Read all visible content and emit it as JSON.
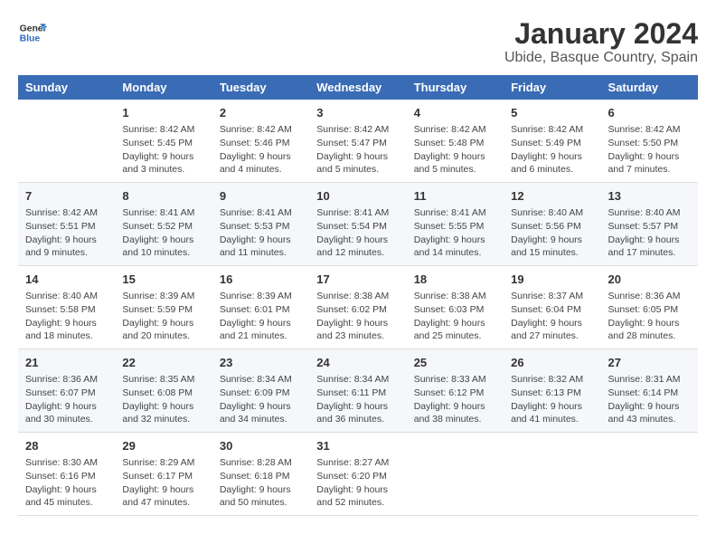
{
  "logo": {
    "text_general": "General",
    "text_blue": "Blue"
  },
  "title": "January 2024",
  "subtitle": "Ubide, Basque Country, Spain",
  "headers": [
    "Sunday",
    "Monday",
    "Tuesday",
    "Wednesday",
    "Thursday",
    "Friday",
    "Saturday"
  ],
  "weeks": [
    [
      {
        "day": "",
        "sunrise": "",
        "sunset": "",
        "daylight": ""
      },
      {
        "day": "1",
        "sunrise": "Sunrise: 8:42 AM",
        "sunset": "Sunset: 5:45 PM",
        "daylight": "Daylight: 9 hours and 3 minutes."
      },
      {
        "day": "2",
        "sunrise": "Sunrise: 8:42 AM",
        "sunset": "Sunset: 5:46 PM",
        "daylight": "Daylight: 9 hours and 4 minutes."
      },
      {
        "day": "3",
        "sunrise": "Sunrise: 8:42 AM",
        "sunset": "Sunset: 5:47 PM",
        "daylight": "Daylight: 9 hours and 5 minutes."
      },
      {
        "day": "4",
        "sunrise": "Sunrise: 8:42 AM",
        "sunset": "Sunset: 5:48 PM",
        "daylight": "Daylight: 9 hours and 5 minutes."
      },
      {
        "day": "5",
        "sunrise": "Sunrise: 8:42 AM",
        "sunset": "Sunset: 5:49 PM",
        "daylight": "Daylight: 9 hours and 6 minutes."
      },
      {
        "day": "6",
        "sunrise": "Sunrise: 8:42 AM",
        "sunset": "Sunset: 5:50 PM",
        "daylight": "Daylight: 9 hours and 7 minutes."
      }
    ],
    [
      {
        "day": "7",
        "sunrise": "Sunrise: 8:42 AM",
        "sunset": "Sunset: 5:51 PM",
        "daylight": "Daylight: 9 hours and 9 minutes."
      },
      {
        "day": "8",
        "sunrise": "Sunrise: 8:41 AM",
        "sunset": "Sunset: 5:52 PM",
        "daylight": "Daylight: 9 hours and 10 minutes."
      },
      {
        "day": "9",
        "sunrise": "Sunrise: 8:41 AM",
        "sunset": "Sunset: 5:53 PM",
        "daylight": "Daylight: 9 hours and 11 minutes."
      },
      {
        "day": "10",
        "sunrise": "Sunrise: 8:41 AM",
        "sunset": "Sunset: 5:54 PM",
        "daylight": "Daylight: 9 hours and 12 minutes."
      },
      {
        "day": "11",
        "sunrise": "Sunrise: 8:41 AM",
        "sunset": "Sunset: 5:55 PM",
        "daylight": "Daylight: 9 hours and 14 minutes."
      },
      {
        "day": "12",
        "sunrise": "Sunrise: 8:40 AM",
        "sunset": "Sunset: 5:56 PM",
        "daylight": "Daylight: 9 hours and 15 minutes."
      },
      {
        "day": "13",
        "sunrise": "Sunrise: 8:40 AM",
        "sunset": "Sunset: 5:57 PM",
        "daylight": "Daylight: 9 hours and 17 minutes."
      }
    ],
    [
      {
        "day": "14",
        "sunrise": "Sunrise: 8:40 AM",
        "sunset": "Sunset: 5:58 PM",
        "daylight": "Daylight: 9 hours and 18 minutes."
      },
      {
        "day": "15",
        "sunrise": "Sunrise: 8:39 AM",
        "sunset": "Sunset: 5:59 PM",
        "daylight": "Daylight: 9 hours and 20 minutes."
      },
      {
        "day": "16",
        "sunrise": "Sunrise: 8:39 AM",
        "sunset": "Sunset: 6:01 PM",
        "daylight": "Daylight: 9 hours and 21 minutes."
      },
      {
        "day": "17",
        "sunrise": "Sunrise: 8:38 AM",
        "sunset": "Sunset: 6:02 PM",
        "daylight": "Daylight: 9 hours and 23 minutes."
      },
      {
        "day": "18",
        "sunrise": "Sunrise: 8:38 AM",
        "sunset": "Sunset: 6:03 PM",
        "daylight": "Daylight: 9 hours and 25 minutes."
      },
      {
        "day": "19",
        "sunrise": "Sunrise: 8:37 AM",
        "sunset": "Sunset: 6:04 PM",
        "daylight": "Daylight: 9 hours and 27 minutes."
      },
      {
        "day": "20",
        "sunrise": "Sunrise: 8:36 AM",
        "sunset": "Sunset: 6:05 PM",
        "daylight": "Daylight: 9 hours and 28 minutes."
      }
    ],
    [
      {
        "day": "21",
        "sunrise": "Sunrise: 8:36 AM",
        "sunset": "Sunset: 6:07 PM",
        "daylight": "Daylight: 9 hours and 30 minutes."
      },
      {
        "day": "22",
        "sunrise": "Sunrise: 8:35 AM",
        "sunset": "Sunset: 6:08 PM",
        "daylight": "Daylight: 9 hours and 32 minutes."
      },
      {
        "day": "23",
        "sunrise": "Sunrise: 8:34 AM",
        "sunset": "Sunset: 6:09 PM",
        "daylight": "Daylight: 9 hours and 34 minutes."
      },
      {
        "day": "24",
        "sunrise": "Sunrise: 8:34 AM",
        "sunset": "Sunset: 6:11 PM",
        "daylight": "Daylight: 9 hours and 36 minutes."
      },
      {
        "day": "25",
        "sunrise": "Sunrise: 8:33 AM",
        "sunset": "Sunset: 6:12 PM",
        "daylight": "Daylight: 9 hours and 38 minutes."
      },
      {
        "day": "26",
        "sunrise": "Sunrise: 8:32 AM",
        "sunset": "Sunset: 6:13 PM",
        "daylight": "Daylight: 9 hours and 41 minutes."
      },
      {
        "day": "27",
        "sunrise": "Sunrise: 8:31 AM",
        "sunset": "Sunset: 6:14 PM",
        "daylight": "Daylight: 9 hours and 43 minutes."
      }
    ],
    [
      {
        "day": "28",
        "sunrise": "Sunrise: 8:30 AM",
        "sunset": "Sunset: 6:16 PM",
        "daylight": "Daylight: 9 hours and 45 minutes."
      },
      {
        "day": "29",
        "sunrise": "Sunrise: 8:29 AM",
        "sunset": "Sunset: 6:17 PM",
        "daylight": "Daylight: 9 hours and 47 minutes."
      },
      {
        "day": "30",
        "sunrise": "Sunrise: 8:28 AM",
        "sunset": "Sunset: 6:18 PM",
        "daylight": "Daylight: 9 hours and 50 minutes."
      },
      {
        "day": "31",
        "sunrise": "Sunrise: 8:27 AM",
        "sunset": "Sunset: 6:20 PM",
        "daylight": "Daylight: 9 hours and 52 minutes."
      },
      {
        "day": "",
        "sunrise": "",
        "sunset": "",
        "daylight": ""
      },
      {
        "day": "",
        "sunrise": "",
        "sunset": "",
        "daylight": ""
      },
      {
        "day": "",
        "sunrise": "",
        "sunset": "",
        "daylight": ""
      }
    ]
  ]
}
